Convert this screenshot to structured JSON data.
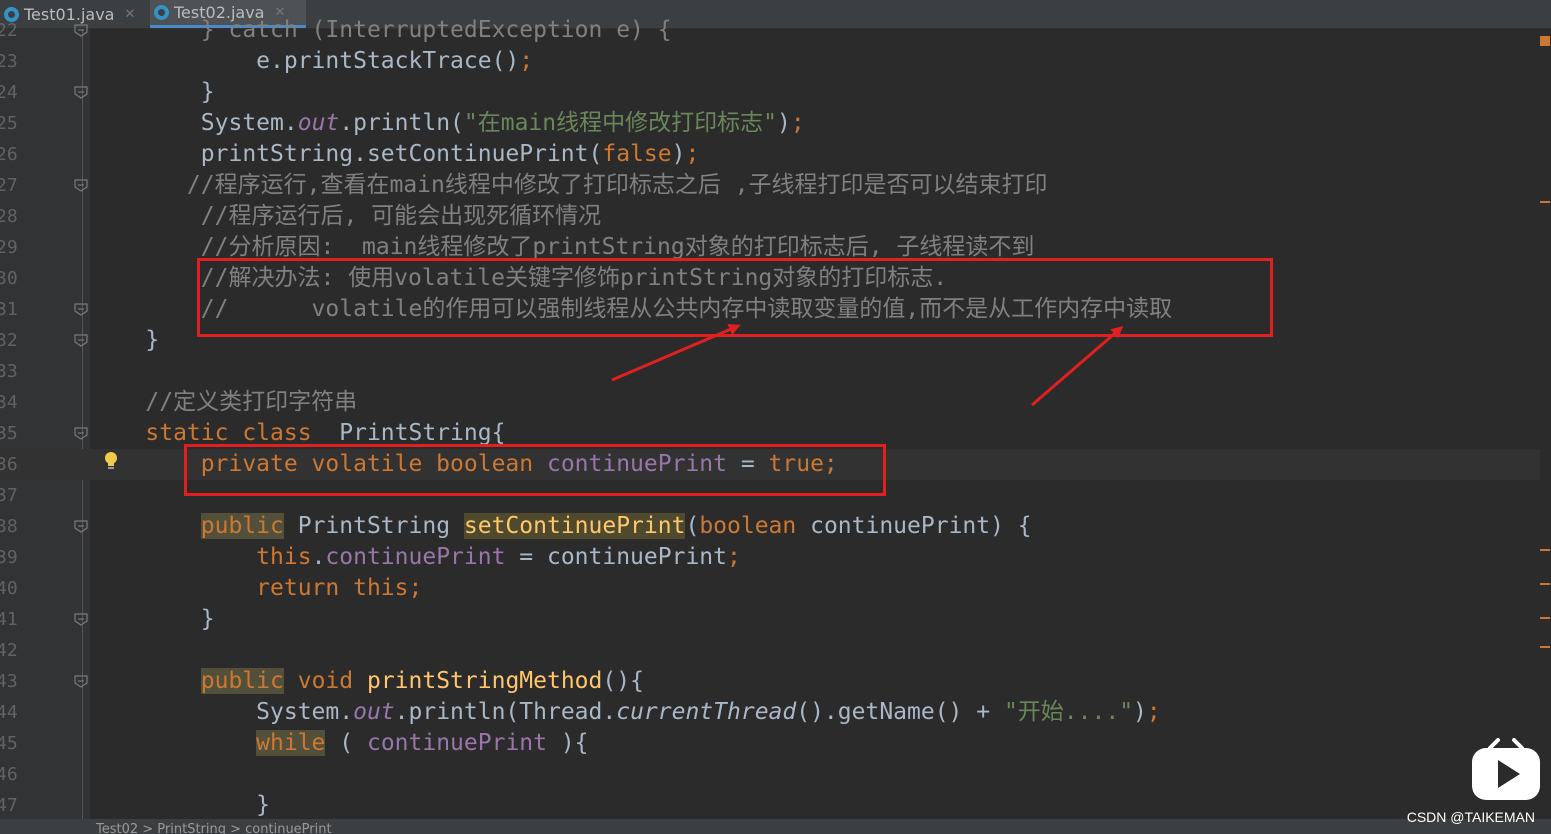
{
  "tabs": [
    {
      "label": "Test01.java"
    },
    {
      "label": "Test02.java"
    }
  ],
  "lines": [
    {
      "num": "22",
      "tokens": [
        {
          "c": "cm",
          "t": "        } catch (InterruptedException e) {"
        }
      ]
    },
    {
      "num": "23",
      "tokens": [
        {
          "c": "",
          "t": "            e.printStackTrace()"
        },
        {
          "c": "kw",
          "t": ";"
        }
      ]
    },
    {
      "num": "24",
      "tokens": [
        {
          "c": "",
          "t": "        }"
        }
      ]
    },
    {
      "num": "25",
      "tokens": [
        {
          "c": "",
          "t": "        System."
        },
        {
          "c": "fld-i",
          "t": "out"
        },
        {
          "c": "",
          "t": ".println("
        },
        {
          "c": "str",
          "t": "\"在main线程中修改打印标志\""
        },
        {
          "c": "",
          "t": ")"
        },
        {
          "c": "kw",
          "t": ";"
        }
      ]
    },
    {
      "num": "26",
      "tokens": [
        {
          "c": "",
          "t": "        printString.setContinuePrint("
        },
        {
          "c": "kw",
          "t": "false"
        },
        {
          "c": "",
          "t": ")"
        },
        {
          "c": "kw",
          "t": ";"
        }
      ]
    },
    {
      "num": "27",
      "tokens": [
        {
          "c": "cm",
          "t": "       //程序运行,查看在main线程中修改了打印标志之后 ,子线程打印是否可以结束打印"
        }
      ]
    },
    {
      "num": "28",
      "tokens": [
        {
          "c": "cm",
          "t": "        //程序运行后, 可能会出现死循环情况"
        }
      ]
    },
    {
      "num": "29",
      "tokens": [
        {
          "c": "cm",
          "t": "        //分析原因:  main线程修改了printString对象的打印标志后, 子线程读不到"
        }
      ]
    },
    {
      "num": "30",
      "tokens": [
        {
          "c": "cm",
          "t": "        //解决办法: 使用volatile关键字修饰printString对象的打印标志."
        }
      ]
    },
    {
      "num": "31",
      "tokens": [
        {
          "c": "cm",
          "t": "        //      volatile的作用可以强制线程从公共内存中读取变量的值,而不是从工作内存中读取"
        }
      ]
    },
    {
      "num": "32",
      "tokens": [
        {
          "c": "",
          "t": "    }"
        }
      ]
    },
    {
      "num": "33",
      "tokens": []
    },
    {
      "num": "34",
      "tokens": [
        {
          "c": "cm",
          "t": "    //定义类打印字符串"
        }
      ]
    },
    {
      "num": "35",
      "tokens": [
        {
          "c": "kw",
          "t": "    static class  "
        },
        {
          "c": "",
          "t": "PrintString{"
        }
      ]
    },
    {
      "num": "36",
      "tokens": [
        {
          "c": "kw",
          "t": "        private volatile boolean "
        },
        {
          "c": "fld",
          "t": "continuePrint"
        },
        {
          "c": "",
          "t": " = "
        },
        {
          "c": "kw",
          "t": "true;"
        }
      ]
    },
    {
      "num": "37",
      "tokens": []
    },
    {
      "num": "38",
      "tokens": [
        {
          "c": "",
          "t": "        "
        },
        {
          "c": "kw hl-usage",
          "t": "public"
        },
        {
          "c": "",
          "t": " PrintString "
        },
        {
          "c": "mth hl-mth",
          "t": "setContinuePrint"
        },
        {
          "c": "",
          "t": "("
        },
        {
          "c": "kw",
          "t": "boolean"
        },
        {
          "c": "",
          "t": " continuePrint) {"
        }
      ]
    },
    {
      "num": "39",
      "tokens": [
        {
          "c": "kw",
          "t": "            this"
        },
        {
          "c": "",
          "t": "."
        },
        {
          "c": "fld",
          "t": "continuePrint"
        },
        {
          "c": "",
          "t": " = continuePrint"
        },
        {
          "c": "kw",
          "t": ";"
        }
      ]
    },
    {
      "num": "40",
      "tokens": [
        {
          "c": "kw",
          "t": "            return this;"
        }
      ]
    },
    {
      "num": "41",
      "tokens": [
        {
          "c": "",
          "t": "        }"
        }
      ]
    },
    {
      "num": "42",
      "tokens": []
    },
    {
      "num": "43",
      "tokens": [
        {
          "c": "",
          "t": "        "
        },
        {
          "c": "kw hl-usage",
          "t": "public"
        },
        {
          "c": "kw",
          "t": " void "
        },
        {
          "c": "mth",
          "t": "printStringMethod"
        },
        {
          "c": "",
          "t": "(){"
        }
      ]
    },
    {
      "num": "44",
      "tokens": [
        {
          "c": "",
          "t": "            System."
        },
        {
          "c": "fld-i",
          "t": "out"
        },
        {
          "c": "",
          "t": ".println(Thread."
        },
        {
          "c": "it",
          "t": "currentThread"
        },
        {
          "c": "",
          "t": "().getName() + "
        },
        {
          "c": "str",
          "t": "\"开始....\""
        },
        {
          "c": "",
          "t": ")"
        },
        {
          "c": "kw",
          "t": ";"
        }
      ]
    },
    {
      "num": "45",
      "tokens": [
        {
          "c": "",
          "t": "            "
        },
        {
          "c": "kw hl-usage",
          "t": "while"
        },
        {
          "c": "",
          "t": " ( "
        },
        {
          "c": "fld",
          "t": "continuePrint"
        },
        {
          "c": "",
          "t": " ){"
        }
      ]
    },
    {
      "num": "46",
      "tokens": []
    },
    {
      "num": "47",
      "tokens": [
        {
          "c": "",
          "t": "            }"
        }
      ]
    }
  ],
  "breadcrumb": "Test02  >  PrintString  >  continuePrint",
  "watermark": "CSDN @TAIKEMAN"
}
